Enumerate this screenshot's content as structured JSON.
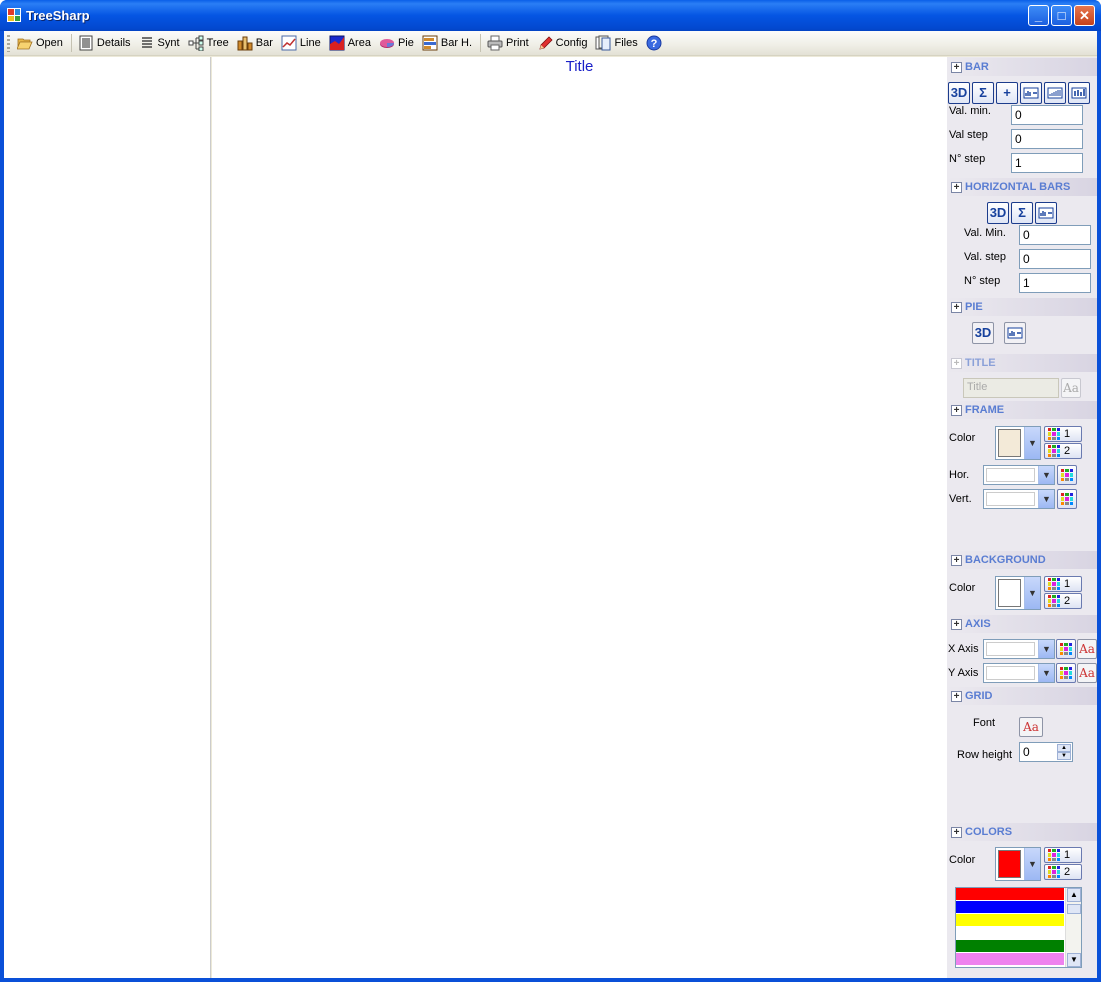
{
  "window": {
    "title": "TreeSharp",
    "minimize": "_",
    "maximize": "□",
    "close": "✕"
  },
  "toolbar": [
    {
      "label": "Open",
      "icon": "folder-open-icon"
    },
    {
      "label": "Details",
      "icon": "details-list-icon"
    },
    {
      "label": "Synt",
      "icon": "synthesis-list-icon"
    },
    {
      "label": "Tree",
      "icon": "tree-icon"
    },
    {
      "label": "Bar",
      "icon": "bar-chart-icon"
    },
    {
      "label": "Line",
      "icon": "line-chart-icon"
    },
    {
      "label": "Area",
      "icon": "area-chart-icon"
    },
    {
      "label": "Pie",
      "icon": "pie-chart-icon"
    },
    {
      "label": "Bar H.",
      "icon": "horizontal-bar-chart-icon"
    },
    {
      "label": "Print",
      "icon": "printer-icon"
    },
    {
      "label": "Config",
      "icon": "config-pencil-icon"
    },
    {
      "label": "Files",
      "icon": "files-icon"
    },
    {
      "label": "",
      "icon": "help-icon"
    }
  ],
  "chart": {
    "title": "Title"
  },
  "panel": {
    "bar": {
      "header": "BAR",
      "buttons": [
        "3D",
        "Σ",
        "+"
      ],
      "val_min_label": "Val. min.",
      "val_min": "0",
      "val_step_label": "Val step",
      "val_step": "0",
      "n_step_label": "N° step",
      "n_step": "1"
    },
    "hbar": {
      "header": "HORIZONTAL BARS",
      "buttons": [
        "3D",
        "Σ"
      ],
      "val_min_label": "Val. Min.",
      "val_min": "0",
      "val_step_label": "Val. step",
      "val_step": "0",
      "n_step_label": "N° step",
      "n_step": "1"
    },
    "pie": {
      "header": "PIE",
      "btn_3d": "3D"
    },
    "title": {
      "header": "TITLE",
      "placeholder": "Title",
      "font_btn": "Aa"
    },
    "frame": {
      "header": "FRAME",
      "color_label": "Color",
      "hor_label": "Hor.",
      "vert_label": "Vert.",
      "btn1": "1",
      "btn2": "2",
      "color": "#f3ead8"
    },
    "background": {
      "header": "BACKGROUND",
      "color_label": "Color",
      "btn1": "1",
      "btn2": "2",
      "color": "#ffffff"
    },
    "axis": {
      "header": "AXIS",
      "x_label": "X Axis",
      "y_label": "Y Axis",
      "font_btn": "Aa"
    },
    "grid": {
      "header": "GRID",
      "font_label": "Font",
      "font_btn": "Aa",
      "row_height_label": "Row height",
      "row_height": "0"
    },
    "colors": {
      "header": "COLORS",
      "color_label": "Color",
      "btn1": "1",
      "btn2": "2",
      "current": "#ff0000",
      "list": [
        "#ff0000",
        "#0000ff",
        "#ffff00",
        "#ffffff",
        "#008000",
        "#ee82ee"
      ]
    }
  }
}
